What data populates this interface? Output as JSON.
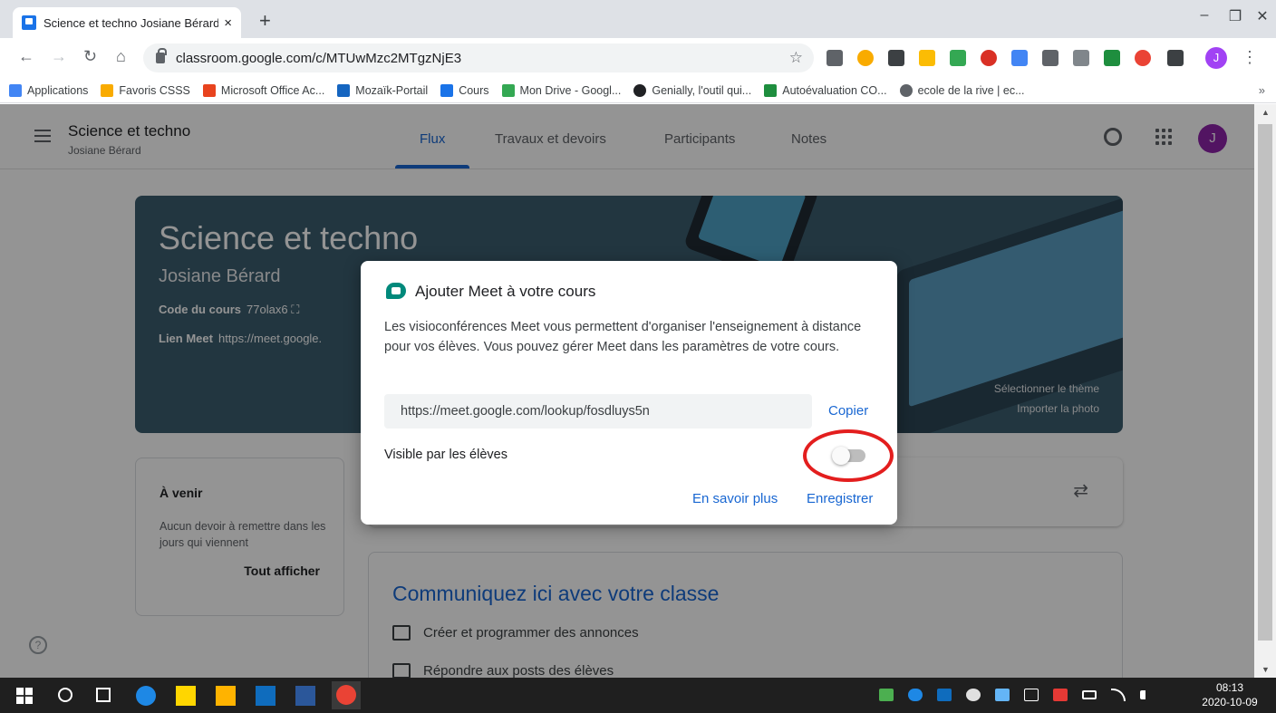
{
  "browser": {
    "tab_title": "Science et techno Josiane Bérard",
    "tab_close": "×",
    "new_tab": "+",
    "url": "classroom.google.com/c/MTUwMzc2MTgzNjE3",
    "profile_initial": "J",
    "window": {
      "minimize": "–",
      "restore": "❐",
      "close": "✕"
    },
    "bookmarks": [
      {
        "label": "Applications",
        "color": "#4285f4"
      },
      {
        "label": "Favoris CSSS",
        "color": "#f9ab00"
      },
      {
        "label": "Microsoft Office Ac...",
        "color": "#e8431e"
      },
      {
        "label": "Mozaïk-Portail",
        "color": "#1565c0"
      },
      {
        "label": "Cours",
        "color": "#1a73e8"
      },
      {
        "label": "Mon Drive - Googl...",
        "color": "#34a853"
      },
      {
        "label": "Genially, l'outil qui...",
        "color": "#202124"
      },
      {
        "label": "Autoévaluation CO...",
        "color": "#1e8e3e"
      },
      {
        "label": "ecole de la rive | ec...",
        "color": "#5f6368"
      }
    ],
    "bookmarks_more": "»"
  },
  "classroom": {
    "course_title": "Science et techno",
    "teacher": "Josiane Bérard",
    "tabs": [
      "Flux",
      "Travaux et devoirs",
      "Participants",
      "Notes"
    ],
    "avatar_initial": "J",
    "banner": {
      "title": "Science et techno",
      "teacher": "Josiane Bérard",
      "code_label": "Code du cours",
      "code_value": "77olax6",
      "meet_label": "Lien Meet",
      "meet_value": "https://meet.google.",
      "select_theme": "Sélectionner le thème",
      "import_photo": "Importer la photo"
    },
    "upcoming": {
      "title": "À venir",
      "none": "Aucun devoir à remettre dans les jours qui viennent",
      "show_all": "Tout afficher"
    },
    "communicate": {
      "title": "Communiquez ici avec votre classe",
      "line1": "Créer et programmer des annonces",
      "line2": "Répondre aux posts des élèves"
    },
    "help": "?"
  },
  "dialog": {
    "title": "Ajouter Meet à votre cours",
    "body": "Les visioconférences Meet vous permettent d'organiser l'enseignement à distance pour vos élèves. Vous pouvez gérer Meet dans les paramètres de votre cours.",
    "link": "https://meet.google.com/lookup/fosdluys5n",
    "copy": "Copier",
    "visible_label": "Visible par les élèves",
    "visible_on": false,
    "learn_more": "En savoir plus",
    "save": "Enregistrer"
  },
  "taskbar": {
    "time": "08:13",
    "date": "2020-10-09"
  },
  "colors": {
    "accent": "#1967d2",
    "banner": "#3c5d6f",
    "highlight_ring": "#e31e1e"
  }
}
